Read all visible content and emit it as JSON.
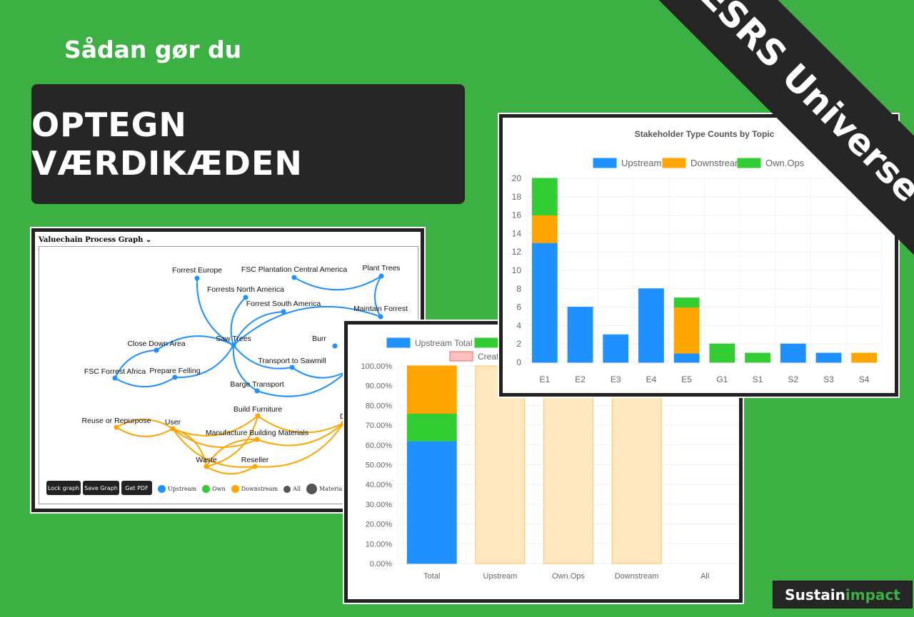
{
  "kicker": "Sådan gør du",
  "title": "OPTEGN VÆRDIKÆDEN",
  "banner": "ESRS Universe",
  "logo": {
    "text": "Sustainimpact",
    "part1": "Sustain",
    "part2": "impact"
  },
  "colors": {
    "background": "#3cb043",
    "upstream": "#1e90ff",
    "own": "#32cd32",
    "downstream": "#ffa500",
    "dark": "#262626"
  },
  "graph_panel": {
    "title": "Valuechain Process Graph",
    "toggle_icon": "chevron-down-icon",
    "nodes": [
      "Forrest Europe",
      "Forrests North America",
      "FSC Plantation Central America",
      "Plant Trees",
      "Forrest South America",
      "Maintain Forrest",
      "Saw Trees",
      "Close Down Area",
      "FSC Forrest Africa",
      "Prepare Felling",
      "Transport to Sawmill",
      "Barge Transport",
      "Burr",
      "S",
      "Reuse or Repurpose",
      "User",
      "Build Furniture",
      "Manufacture Building Materials",
      "Waste",
      "Reseller",
      "Di"
    ],
    "buttons": [
      "Lock graph",
      "Save Graph",
      "Get PDF"
    ],
    "legend": [
      {
        "label": "Upstream",
        "color": "#1e90ff"
      },
      {
        "label": "Own",
        "color": "#32cd32"
      },
      {
        "label": "Downstream",
        "color": "#ffa500"
      },
      {
        "label": "All",
        "color": "#555555"
      },
      {
        "label": "Material",
        "color": "#555555"
      }
    ]
  },
  "chart_data": [
    {
      "type": "bar",
      "stacked": true,
      "title": "",
      "categories": [
        "Total",
        "Upstream",
        "Own.Ops",
        "Downstream",
        "All"
      ],
      "legend": [
        "Upstream Total",
        "",
        "Create"
      ],
      "series": [
        {
          "name": "Upstream Total",
          "color": "#1e90ff",
          "values": [
            62,
            0,
            0,
            0,
            0
          ]
        },
        {
          "color": "#32cd32",
          "values": [
            14,
            0,
            0,
            0,
            0
          ]
        },
        {
          "color": "#ffa500",
          "values": [
            24,
            0,
            0,
            0,
            0
          ]
        },
        {
          "color": "#ffe8c0",
          "values": [
            0,
            100,
            100,
            100,
            0
          ]
        }
      ],
      "yticks": [
        "0.00%",
        "10.00%",
        "20.00%",
        "30.00%",
        "40.00%",
        "50.00%",
        "60.00%",
        "70.00%",
        "80.00%",
        "90.00%",
        "100.00%"
      ],
      "ylim": [
        0,
        100
      ],
      "grid": true,
      "legend_placement": "top"
    },
    {
      "type": "bar",
      "stacked": true,
      "title": "Stakeholder Type Counts by Topic",
      "categories": [
        "E1",
        "E2",
        "E3",
        "E4",
        "E5",
        "G1",
        "S1",
        "S2",
        "S3",
        "S4"
      ],
      "series": [
        {
          "name": "Upstream",
          "color": "#1e90ff",
          "values": [
            13,
            6,
            3,
            8,
            1,
            0,
            0,
            2,
            1,
            0
          ]
        },
        {
          "name": "Downstream",
          "color": "#ffa500",
          "values": [
            3,
            0,
            0,
            0,
            5,
            0,
            0,
            0,
            0,
            1
          ]
        },
        {
          "name": "Own.Ops",
          "color": "#32cd32",
          "values": [
            4,
            0,
            0,
            0,
            1,
            2,
            1,
            0,
            0,
            0
          ]
        }
      ],
      "yticks": [
        "0",
        "2",
        "4",
        "6",
        "8",
        "10",
        "12",
        "14",
        "16",
        "18",
        "20"
      ],
      "ylim": [
        0,
        20
      ],
      "grid": true,
      "legend_placement": "top"
    }
  ]
}
